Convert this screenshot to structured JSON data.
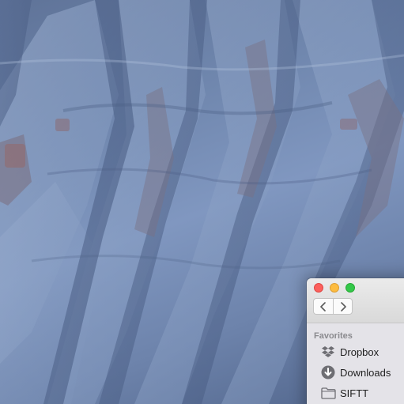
{
  "desktop": {
    "wallpaper": "blue-badlands-ridges",
    "colors": {
      "wallpaper_base": "#6f86ad",
      "wallpaper_shadow": "#4d6086",
      "wallpaper_highlight": "#a8bad6"
    }
  },
  "finder": {
    "traffic_lights": {
      "close_color": "#fc605c",
      "minimize_color": "#fdbc40",
      "zoom_color": "#34c84a"
    },
    "toolbar": {
      "back_icon": "chevron-left-icon",
      "forward_icon": "chevron-right-icon"
    },
    "sidebar": {
      "section_title": "Favorites",
      "items": [
        {
          "label": "Dropbox",
          "icon": "dropbox-icon"
        },
        {
          "label": "Downloads",
          "icon": "downloads-icon"
        },
        {
          "label": "SIFTT",
          "icon": "folder-icon"
        }
      ]
    }
  }
}
